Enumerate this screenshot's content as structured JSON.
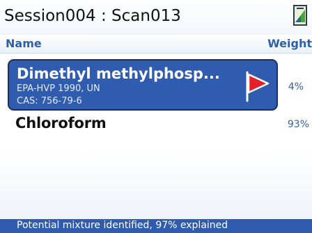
{
  "title": {
    "text": "Session004 : Scan013",
    "status_icon": "signal-battery-icon"
  },
  "columns": {
    "name": "Name",
    "weight": "Weight"
  },
  "results": [
    {
      "name": "Dimethyl methylphosp...",
      "line1": "EPA-HVP 1990, UN",
      "line2": "CAS: 756-79-6",
      "weight": "4%",
      "selected": true,
      "icon": "red-flag-icon"
    },
    {
      "name": "Chloroform",
      "weight": "93%",
      "selected": false
    }
  ],
  "status": {
    "text": "Potential mixture identified, 97% explained"
  },
  "colors": {
    "accent": "#2f5cae",
    "header_text": "#2f5fa8",
    "flag": "#e5202a"
  }
}
